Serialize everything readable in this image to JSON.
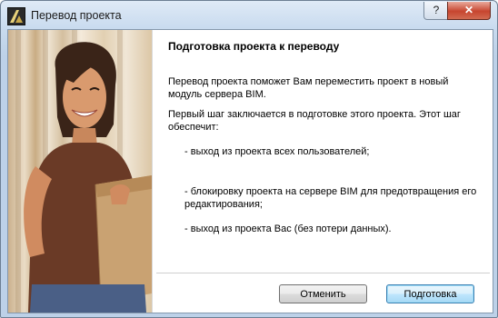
{
  "window": {
    "title": "Перевод проекта",
    "help_label": "?",
    "close_label": "✕"
  },
  "content": {
    "heading": "Подготовка проекта к переводу",
    "intro": "Перевод проекта поможет Вам переместить проект в новый модуль сервера BIM.",
    "first_step": "Первый шаг заключается в подготовке этого проекта. Этот шаг обеспечит:",
    "bullets": [
      "- выход из проекта всех пользователей;",
      "- блокировку проекта на сервере BIM для предотвращения его редактирования;",
      "- выход из проекта Вас (без потери данных)."
    ]
  },
  "buttons": {
    "cancel": "Отменить",
    "prepare": "Подготовка"
  }
}
